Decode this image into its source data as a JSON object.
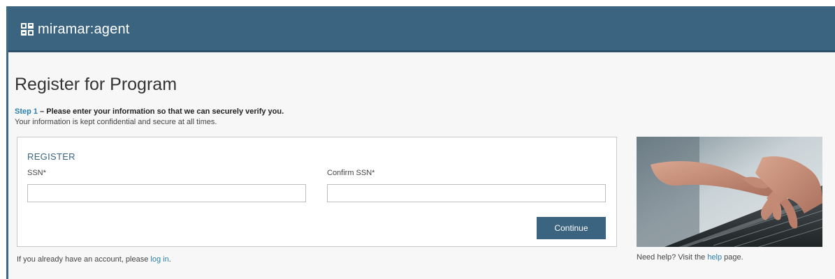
{
  "brand": {
    "name": "miramar:agent",
    "icon": "app-grid-icon"
  },
  "page": {
    "title": "Register for Program",
    "step_label": "Step 1",
    "step_text": " – Please enter your information so that we can securely verify you.",
    "subtitle": "Your information is kept confidential and secure at all times."
  },
  "form": {
    "heading": "REGISTER",
    "ssn_label": "SSN*",
    "ssn_value": "",
    "confirm_label": "Confirm SSN*",
    "confirm_value": "",
    "continue_label": "Continue"
  },
  "login": {
    "prefix": "If you already have an account, please ",
    "link": "log in",
    "suffix": "."
  },
  "help": {
    "prefix": "Need help? Visit the ",
    "link": "help",
    "suffix": " page."
  },
  "image": {
    "subject": "hands-typing-on-laptop"
  },
  "colors": {
    "header": "#3a6480",
    "accent": "#3a6480",
    "link": "#2a7fb0",
    "background": "#f7f7f7"
  }
}
